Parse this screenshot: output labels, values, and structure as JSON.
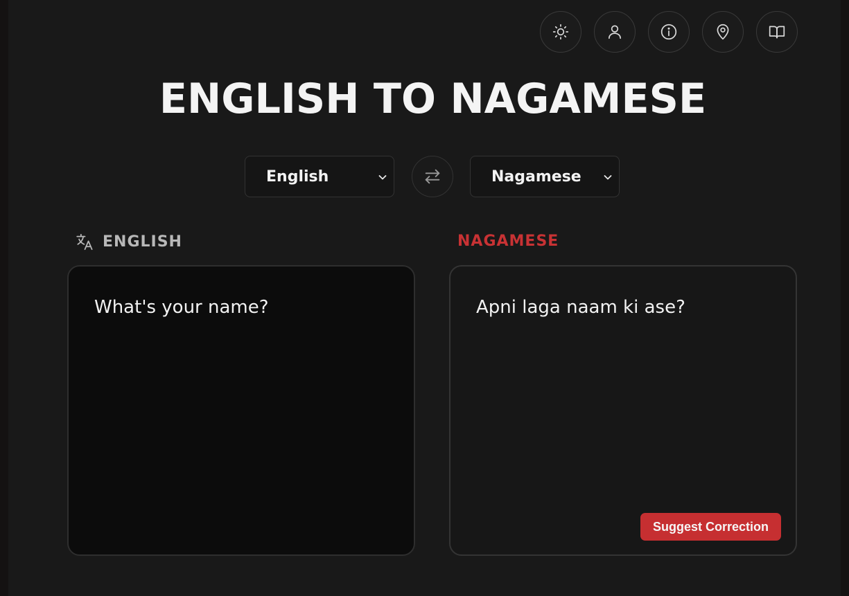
{
  "header": {
    "title": "ENGLISH TO NAGAMESE",
    "icons": [
      "sun-icon",
      "user-icon",
      "info-icon",
      "location-pin-icon",
      "book-open-icon"
    ]
  },
  "language_bar": {
    "source_language": "English",
    "target_language": "Nagamese",
    "swap_icon": "swap-arrows-icon"
  },
  "source_panel": {
    "label": "ENGLISH",
    "icon": "translate-icon",
    "text": "What's your name?"
  },
  "target_panel": {
    "label": "NAGAMESE",
    "text": "Apni laga naam ki ase?",
    "suggest_label": "Suggest Correction"
  },
  "colors": {
    "accent": "#c62f31",
    "background": "#191919",
    "source_label": "#b8b8b8",
    "target_label": "#c83234"
  }
}
